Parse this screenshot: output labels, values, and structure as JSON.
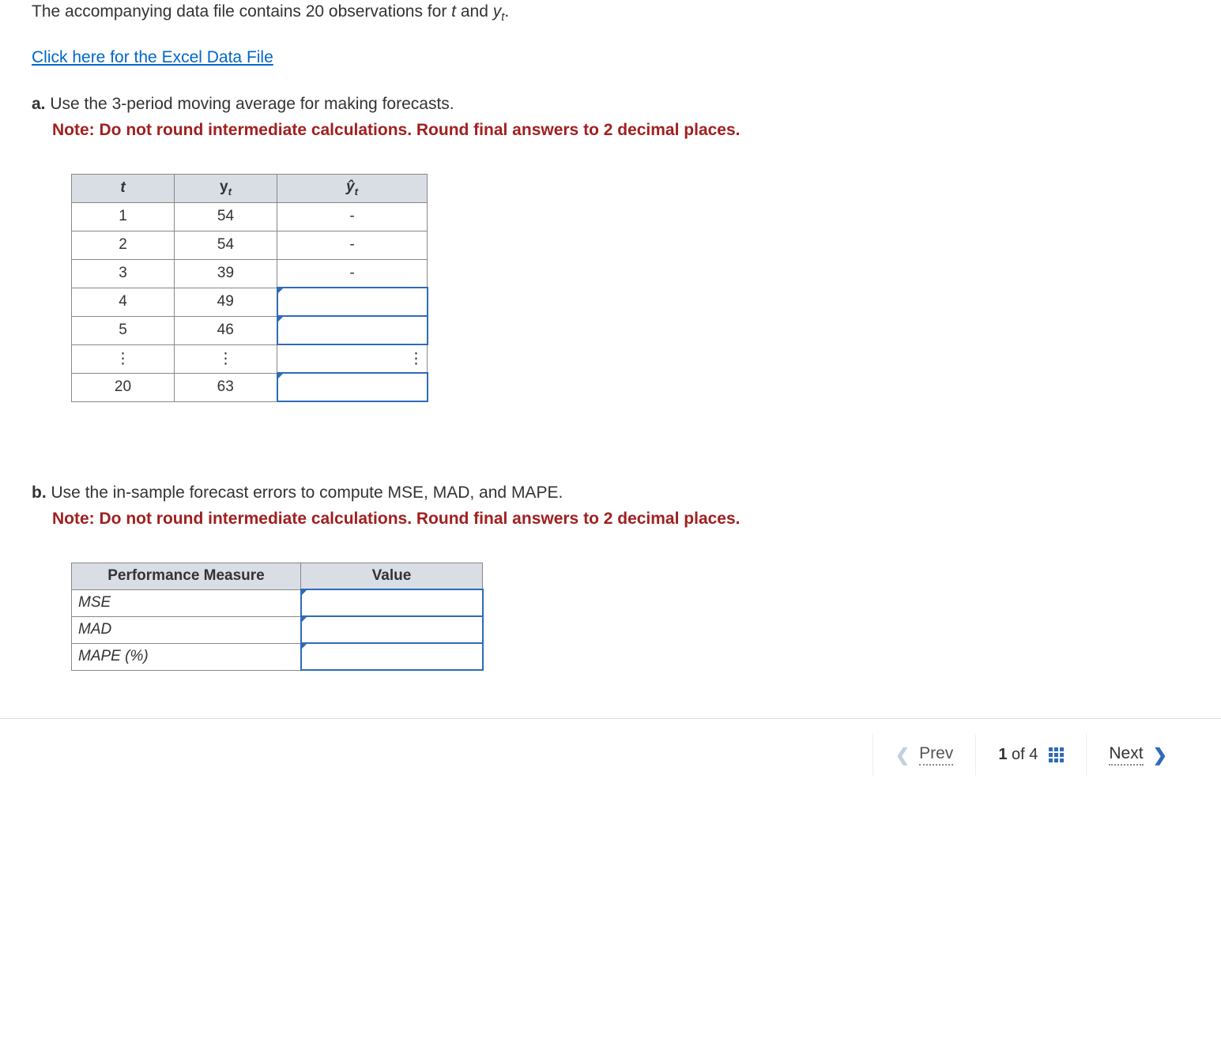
{
  "intro": {
    "text_prefix": "The accompanying data file contains 20 observations for ",
    "var_t": "t",
    "text_mid": " and ",
    "var_y": "y",
    "var_y_sub": "t",
    "text_suffix": "."
  },
  "excel_link": "Click here for the Excel Data File",
  "part_a": {
    "letter": "a.",
    "prompt": "Use the 3-period moving average for making forecasts.",
    "note": "Note: Do not round intermediate calculations. Round final answers to 2 decimal places.",
    "headers": {
      "t": "t",
      "yt_base": "y",
      "yt_sub": "t",
      "yhat_base": "ŷ",
      "yhat_sub": "t"
    },
    "rows": [
      {
        "t": "1",
        "yt": "54",
        "yhat": "-",
        "yhat_input": false
      },
      {
        "t": "2",
        "yt": "54",
        "yhat": "-",
        "yhat_input": false
      },
      {
        "t": "3",
        "yt": "39",
        "yhat": "-",
        "yhat_input": false
      },
      {
        "t": "4",
        "yt": "49",
        "yhat": "",
        "yhat_input": true
      },
      {
        "t": "5",
        "yt": "46",
        "yhat": "",
        "yhat_input": true
      },
      {
        "t": "⋮",
        "yt": "⋮",
        "yhat": "⋮",
        "yhat_input": false,
        "ellipsis_right": true
      },
      {
        "t": "20",
        "yt": "63",
        "yhat": "",
        "yhat_input": true
      }
    ]
  },
  "part_b": {
    "letter": "b.",
    "prompt_prefix": "Use the in-sample forecast errors to compute ",
    "prompt_mse": "MSE",
    "prompt_comma1": ", ",
    "prompt_mad": "MAD",
    "prompt_comma2": ", and ",
    "prompt_mape": "MAPE",
    "prompt_suffix": ".",
    "note": "Note: Do not round intermediate calculations. Round final answers to 2 decimal places.",
    "headers": {
      "measure": "Performance Measure",
      "value": "Value"
    },
    "rows": [
      {
        "label": "MSE"
      },
      {
        "label": "MAD"
      },
      {
        "label": "MAPE (%)"
      }
    ]
  },
  "nav": {
    "prev": "Prev",
    "page_current": "1",
    "page_of": "of",
    "page_total": "4",
    "next": "Next"
  }
}
